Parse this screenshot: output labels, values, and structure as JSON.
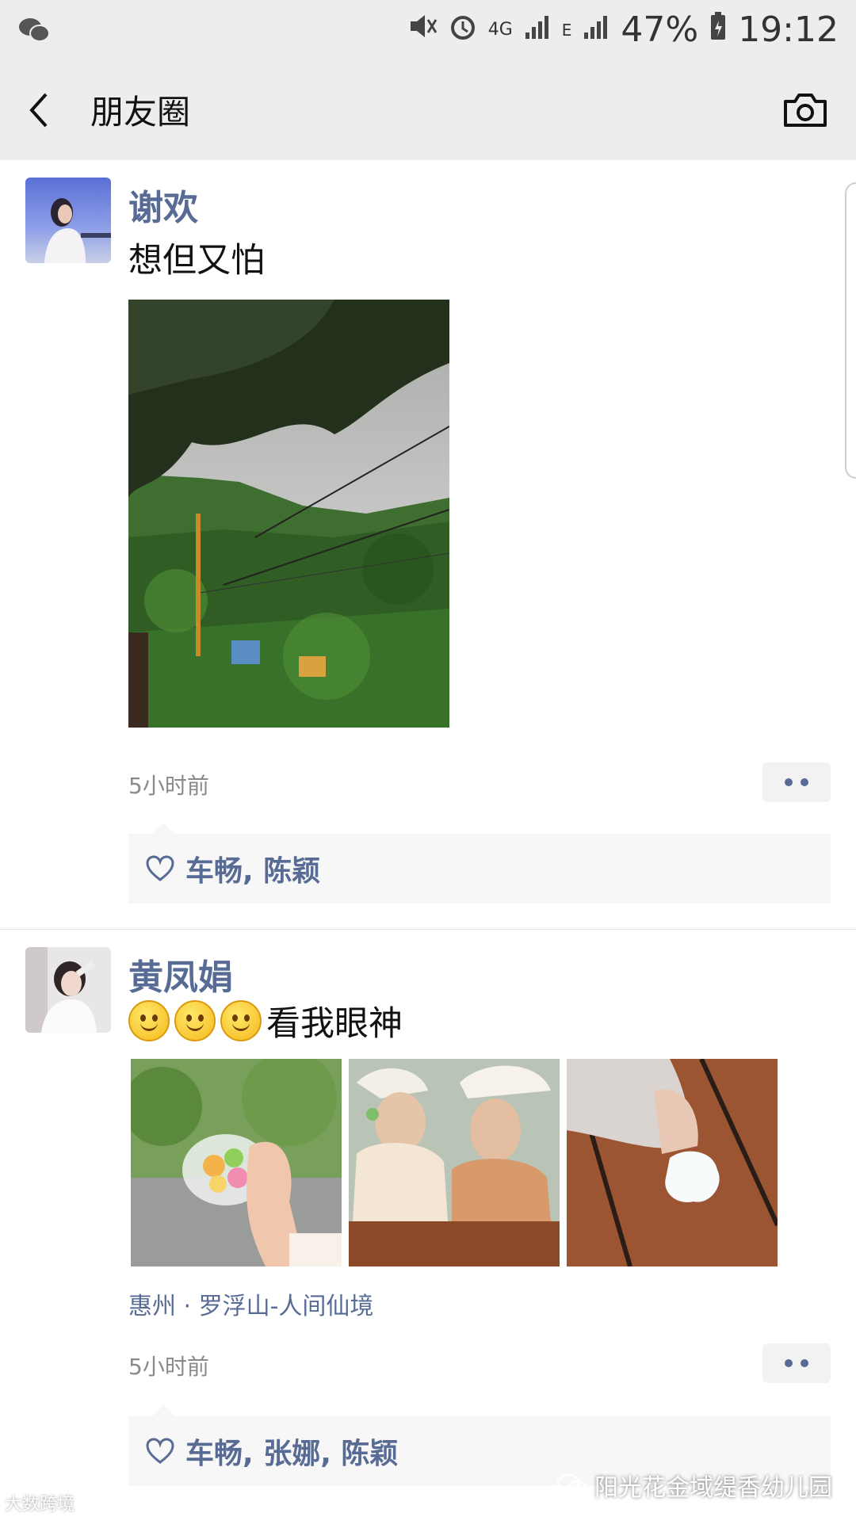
{
  "status_bar": {
    "network": "4G",
    "network2": "E",
    "battery": "47%",
    "time": "19:12",
    "icons": [
      "wechat-icon",
      "mute-icon",
      "alarm-icon",
      "signal-icon",
      "battery-icon"
    ]
  },
  "nav": {
    "title": "朋友圈",
    "back_icon": "chevron-left-icon",
    "camera_icon": "camera-icon"
  },
  "posts": [
    {
      "username": "谢欢",
      "text": "想但又怕",
      "time": "5小时前",
      "likes": "车畅, 陈颖"
    },
    {
      "username": "黄凤娟",
      "text": "看我眼神",
      "emoji_count": 3,
      "location": "惠州 · 罗浮山-人间仙境",
      "time": "5小时前",
      "likes": "车畅, 张娜, 陈颖"
    }
  ],
  "watermarks": {
    "left": "大数跨境",
    "right": "阳光花金域缇香幼儿园"
  },
  "colors": {
    "link_blue": "#576b95",
    "bar_gray": "#ededed"
  }
}
